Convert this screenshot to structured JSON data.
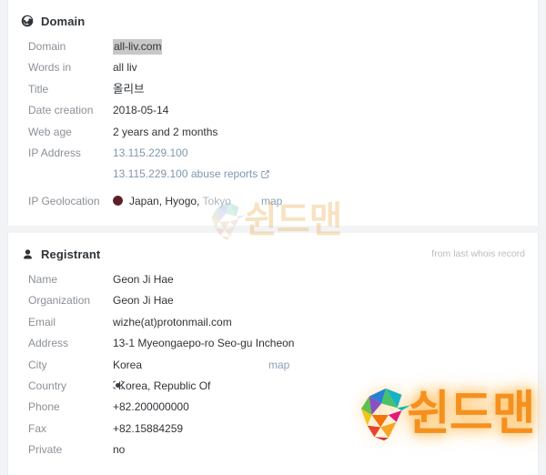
{
  "domain_section": {
    "icon": "globe-icon",
    "title": "Domain",
    "rows": [
      {
        "label": "Domain",
        "value": "all-liv.com",
        "style": "highlight"
      },
      {
        "label": "Words in",
        "value": "all liv",
        "style": "plain"
      },
      {
        "label": "Title",
        "value": "올리브",
        "style": "korean"
      },
      {
        "label": "Date creation",
        "value": "2018-05-14",
        "style": "plain"
      },
      {
        "label": "Web age",
        "value": "2 years and 2 months",
        "style": "plain"
      },
      {
        "label": "IP Address",
        "value": "13.115.229.100",
        "style": "link"
      }
    ],
    "abuse_link": {
      "label": "13.115.229.100 abuse reports",
      "icon": "external-link-icon"
    },
    "geolocation": {
      "label": "IP Geolocation",
      "flag": "flag-japan-icon",
      "primary": "Japan, Hyogo,",
      "secondary": "Tokyo",
      "map_label": "map"
    }
  },
  "registrant_section": {
    "icon": "user-icon",
    "title": "Registrant",
    "note": "from last whois record",
    "rows": [
      {
        "label": "Name",
        "value": "Geon Ji Hae"
      },
      {
        "label": "Organization",
        "value": "Geon Ji Hae"
      },
      {
        "label": "Email",
        "value": "wizhe(at)protonmail.com"
      },
      {
        "label": "Address",
        "value": "13-1 Myeongaepo-ro Seo-gu Incheon"
      }
    ],
    "city": {
      "label": "City",
      "value": "Korea",
      "map_label": "map"
    },
    "country": {
      "label": "Country",
      "flag": "flag-south-korea-icon",
      "value": "Korea, Republic Of"
    },
    "rows_tail": [
      {
        "label": "Phone",
        "value": "+82.200000000"
      },
      {
        "label": "Fax",
        "value": "+82.15884259"
      },
      {
        "label": "Private",
        "value": "no"
      }
    ]
  },
  "watermarks": {
    "top": {
      "logo": "shieldman-s-logo",
      "text": "쉰드맨"
    },
    "bottom": {
      "logo": "shieldman-s-logo",
      "text": "쉰드맨"
    }
  },
  "colors": {
    "background": "#f2f3f5",
    "card": "#ffffff",
    "label": "#8b9096",
    "value": "#2f3337",
    "link": "#7f97ad",
    "muted": "#b0b5ba",
    "highlight": "#c8c8c8",
    "watermark_orange": "#f5901e"
  }
}
